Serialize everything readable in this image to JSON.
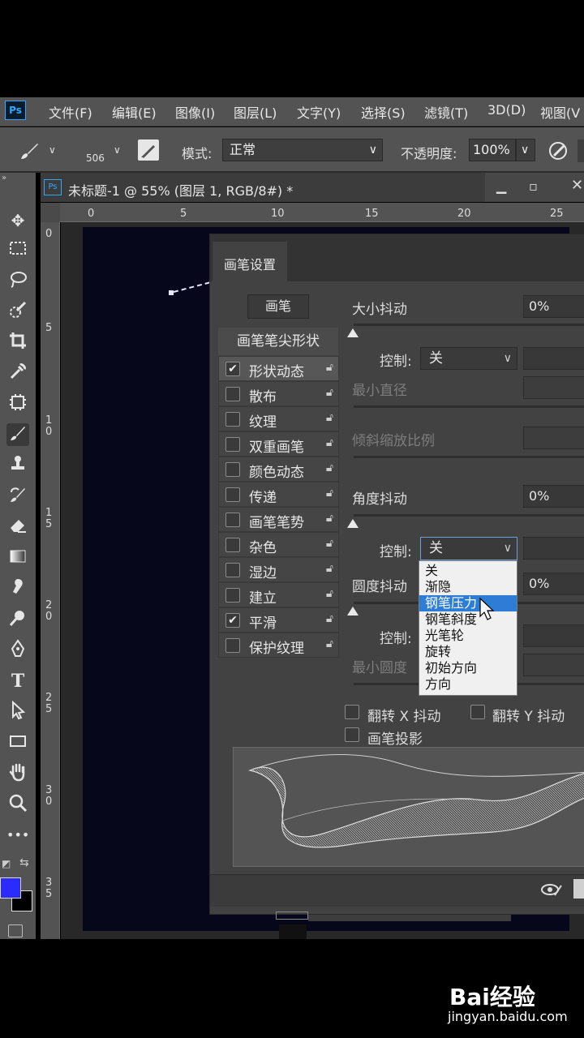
{
  "app": {
    "logo": "Ps"
  },
  "menu": [
    "文件(F)",
    "编辑(E)",
    "图像(I)",
    "图层(L)",
    "文字(Y)",
    "选择(S)",
    "滤镜(T)",
    "3D(D)",
    "视图(V"
  ],
  "options_bar": {
    "brush_size": "506",
    "mode_label": "模式:",
    "mode_value": "正常",
    "opacity_label": "不透明度:",
    "opacity_value": "100%"
  },
  "document": {
    "tab_icon": "Ps",
    "tab_title": "未标题-1 @ 55% (图层 1, RGB/8#) *",
    "ruler_top": [
      "0",
      "5",
      "10",
      "15",
      "20",
      "25"
    ],
    "ruler_left": [
      "0",
      "5",
      "10",
      "15",
      "20",
      "25",
      "30",
      "35"
    ]
  },
  "colors": {
    "foreground": "#2b2bff",
    "background": "#000000",
    "accent": "#2d7cd6"
  },
  "brush_panel": {
    "tab_label": "画笔设置",
    "brush_button": "画笔",
    "tip_shape": "画笔笔尖形状",
    "options": [
      {
        "label": "形状动态",
        "checked": true,
        "selected": true
      },
      {
        "label": "散布",
        "checked": false
      },
      {
        "label": "纹理",
        "checked": false
      },
      {
        "label": "双重画笔",
        "checked": false
      },
      {
        "label": "颜色动态",
        "checked": false
      },
      {
        "label": "传递",
        "checked": false
      },
      {
        "label": "画笔笔势",
        "checked": false
      },
      {
        "label": "杂色",
        "checked": false
      },
      {
        "label": "湿边",
        "checked": false
      },
      {
        "label": "建立",
        "checked": false
      },
      {
        "label": "平滑",
        "checked": true
      },
      {
        "label": "保护纹理",
        "checked": false
      }
    ],
    "size_jitter": {
      "label": "大小抖动",
      "value": "0%"
    },
    "control_label": "控制:",
    "control_value": "关",
    "min_diameter": "最小直径",
    "tilt_scale": "倾斜缩放比例",
    "angle_jitter": {
      "label": "角度抖动",
      "value": "0%"
    },
    "roundness_jitter": {
      "label": "圆度抖动",
      "value": "0%"
    },
    "min_roundness": "最小圆度",
    "flip_x": "翻转 X 抖动",
    "flip_y": "翻转 Y 抖动",
    "brush_projection": "画笔投影",
    "dropdown_options": [
      "关",
      "渐隐",
      "钢笔压力",
      "钢笔斜度",
      "光笔轮",
      "旋转",
      "初始方向",
      "方向"
    ],
    "dropdown_highlighted": "钢笔压力"
  },
  "watermark": {
    "logo": "Bai经验",
    "url": "jingyan.baidu.com"
  }
}
